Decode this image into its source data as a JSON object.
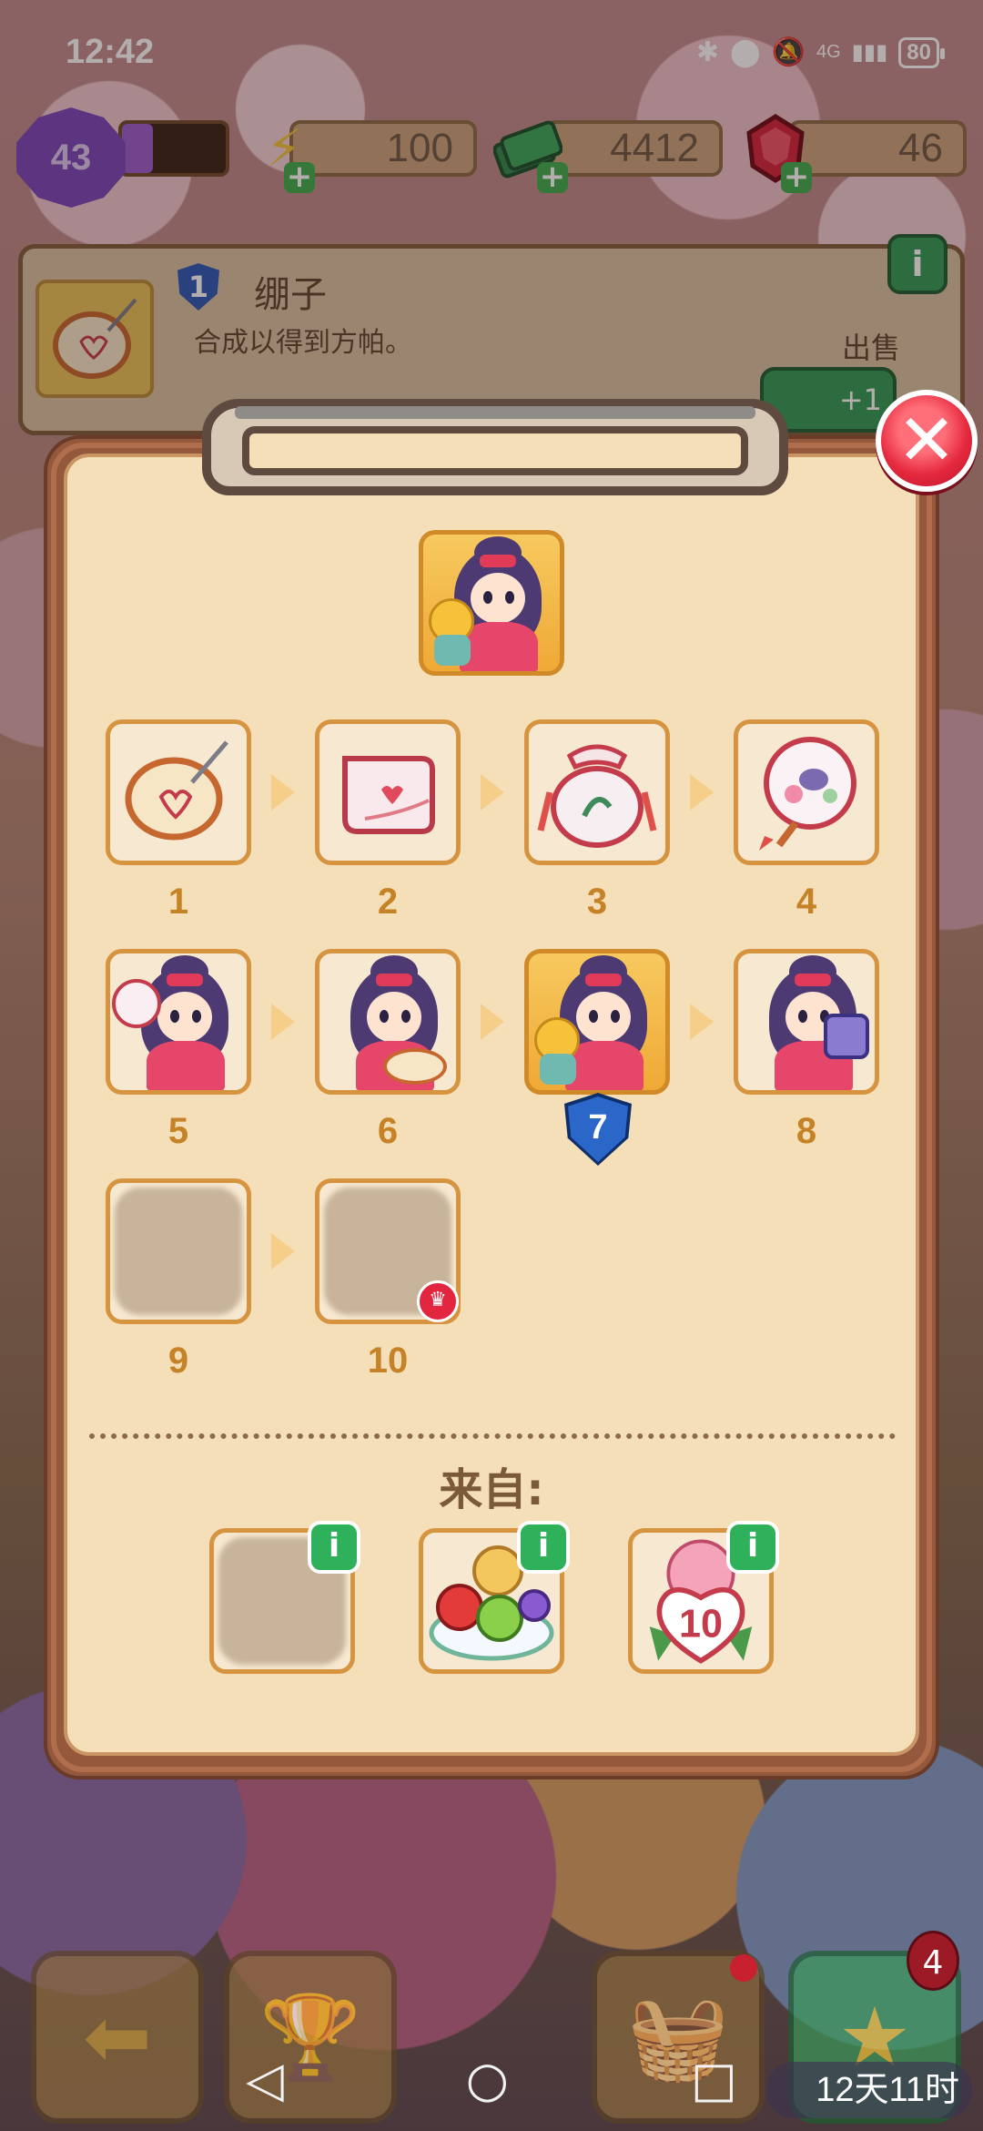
{
  "status_bar": {
    "time": "12:42",
    "network": "4G",
    "battery": "80"
  },
  "resources": {
    "level": "43",
    "energy": "100",
    "cash": "4412",
    "gems": "46",
    "level_progress": 0.3
  },
  "item_info": {
    "level": "1",
    "title": "绷子",
    "description": "合成以得到方帕。",
    "sell_label": "出售",
    "sell_value": "+1"
  },
  "chain": {
    "featured_level": "7",
    "items": [
      {
        "num": "1",
        "kind": "embroidery-hoop"
      },
      {
        "num": "2",
        "kind": "handkerchief"
      },
      {
        "num": "3",
        "kind": "pouch"
      },
      {
        "num": "4",
        "kind": "round-fan"
      },
      {
        "num": "5",
        "kind": "lady-with-fan"
      },
      {
        "num": "6",
        "kind": "lady-embroidering"
      },
      {
        "num": "7",
        "kind": "lady-with-flowers"
      },
      {
        "num": "8",
        "kind": "lady-with-gift"
      },
      {
        "num": "9",
        "kind": "locked"
      },
      {
        "num": "10",
        "kind": "locked"
      }
    ]
  },
  "from_section": {
    "label": "来自:",
    "source_3_value": "10"
  },
  "bottom": {
    "timer": "12天11时",
    "badge_count": "4"
  },
  "colors": {
    "modal_bg": "#f4dfb8",
    "tile_border": "#d69440",
    "close_red": "#e5283e",
    "info_green": "#2fb15b",
    "level_blue": "#2a67c9"
  }
}
